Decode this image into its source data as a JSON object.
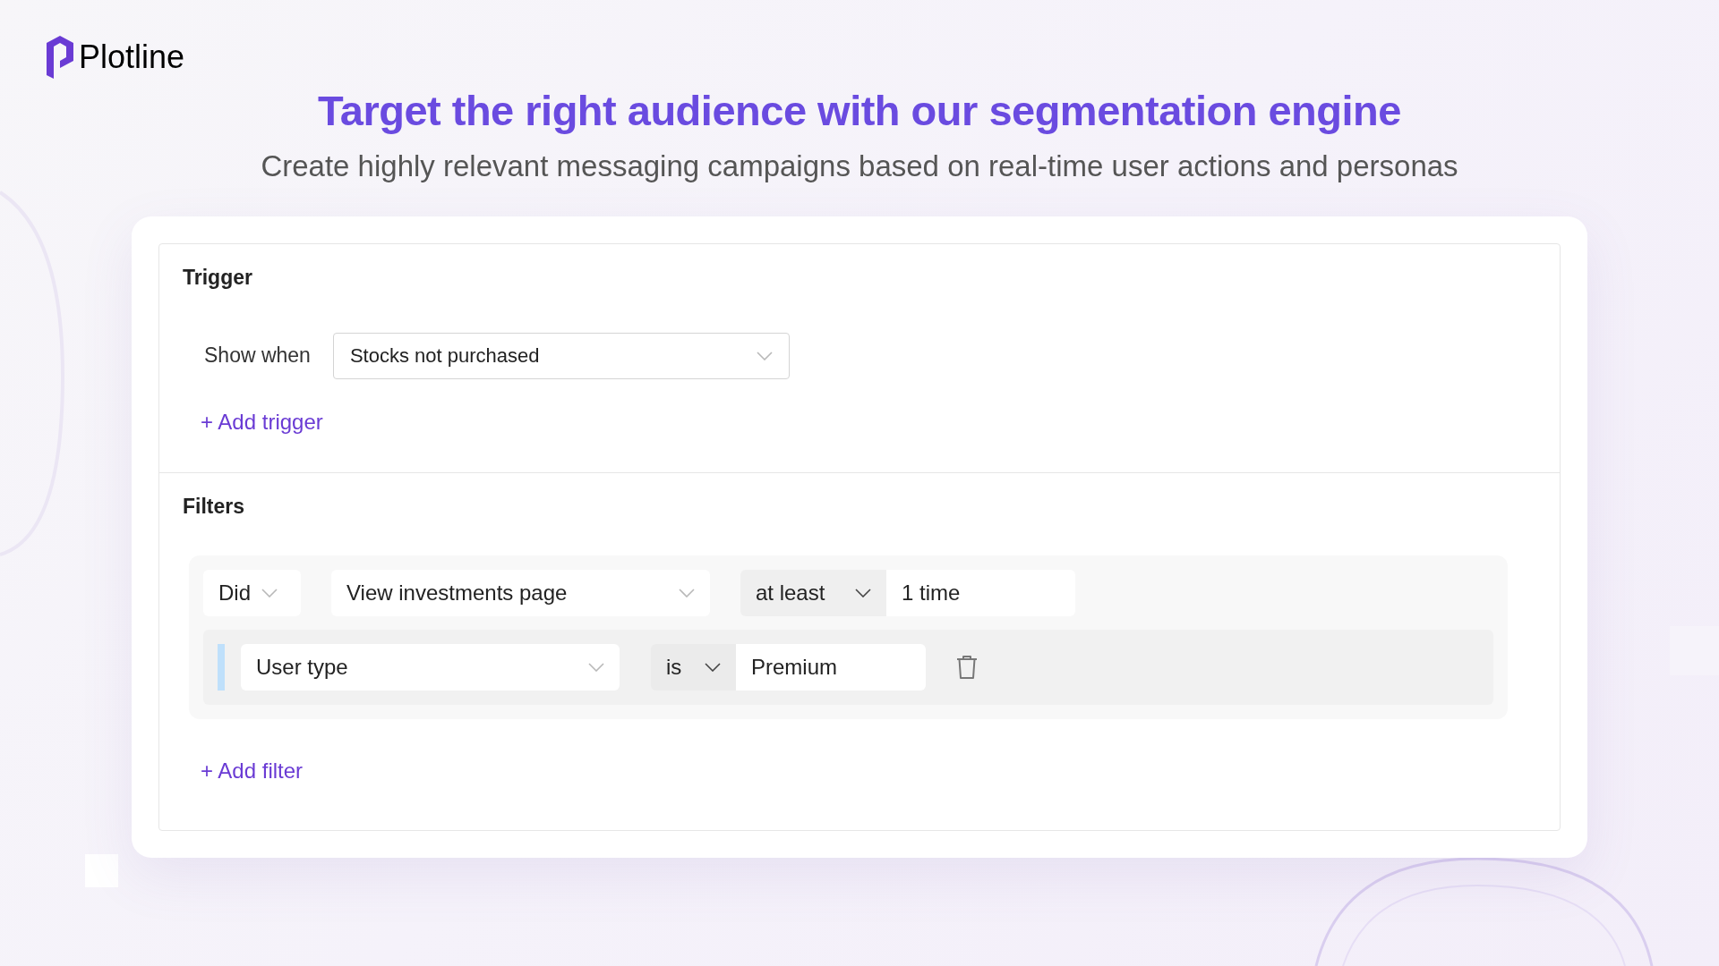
{
  "brand": {
    "name": "Plotline"
  },
  "headline": "Target the right audience with our segmentation engine",
  "subheadline": "Create highly relevant messaging campaigns based on real-time user actions and personas",
  "trigger": {
    "title": "Trigger",
    "label": "Show when",
    "select": {
      "value": "Stocks not purchased"
    },
    "add_link": "+ Add trigger"
  },
  "filters": {
    "title": "Filters",
    "event_row": {
      "did": "Did",
      "event": "View investments page",
      "operator": "at least",
      "count": "1 time"
    },
    "property_row": {
      "property": "User type",
      "operator": "is",
      "value": "Premium"
    },
    "add_link": "+ Add filter"
  }
}
